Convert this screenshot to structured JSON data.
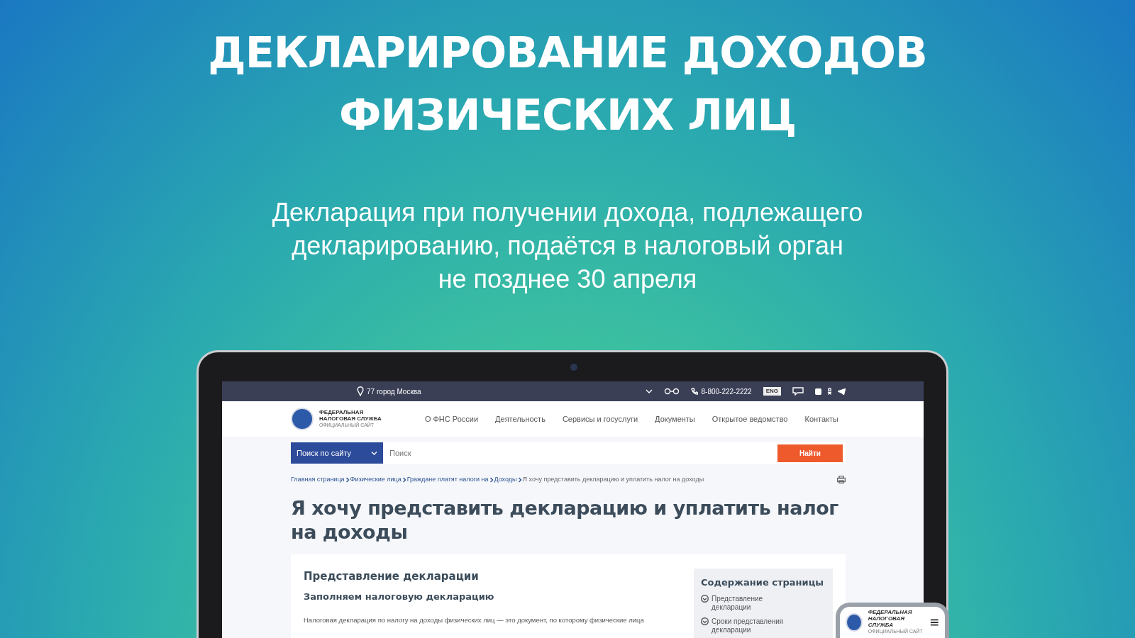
{
  "banner": {
    "title_lines": [
      "ДЕКЛАРИРОВАНИЕ ДОХОДОВ",
      "ФИЗИЧЕСКИХ ЛИЦ"
    ],
    "subtitle_lines": [
      "Декларация при получении дохода, подлежащего",
      "декларированию, подаётся в налоговый орган",
      "не позднее 30 апреля"
    ]
  },
  "site": {
    "topbar": {
      "region": "77 город Москва",
      "phone": "8-800-222-2222",
      "language": "ENG"
    },
    "logo": {
      "lines": [
        "ФЕДЕРАЛЬНАЯ",
        "НАЛОГОВАЯ СЛУЖБА"
      ],
      "tagline": "ОФИЦИАЛЬНЫЙ САЙТ"
    },
    "nav": [
      "О ФНС России",
      "Деятельность",
      "Сервисы и госуслуги",
      "Документы",
      "Открытое ведомство",
      "Контакты"
    ],
    "search": {
      "scope": "Поиск по сайту",
      "placeholder": "Поиск",
      "button": "Найти"
    },
    "breadcrumbs": [
      {
        "label": "Главная страница",
        "current": false
      },
      {
        "label": "Физические лица",
        "current": false
      },
      {
        "label": "Граждане платят налоги на",
        "current": false
      },
      {
        "label": "Доходы",
        "current": false
      },
      {
        "label": "Я хочу представить декларацию и уплатить налог на доходы",
        "current": true
      }
    ],
    "page_title": "Я хочу представить декларацию и уплатить налог на доходы",
    "content": {
      "section_title": "Представление декларации",
      "subsection_title": "Заполняем налоговую декларацию",
      "paragraph": "Налоговая декларация по налогу на доходы физических лиц — это документ, по которому физические лица"
    },
    "toc": {
      "title": "Содержание страницы",
      "items": [
        "Представление декларации",
        "Сроки представления декларации"
      ]
    }
  },
  "phone": {
    "logo_lines": [
      "ФЕДЕРАЛЬНАЯ",
      "НАЛОГОВАЯ СЛУЖБА"
    ],
    "tagline": "ОФИЦИАЛЬНЫЙ САЙТ"
  }
}
